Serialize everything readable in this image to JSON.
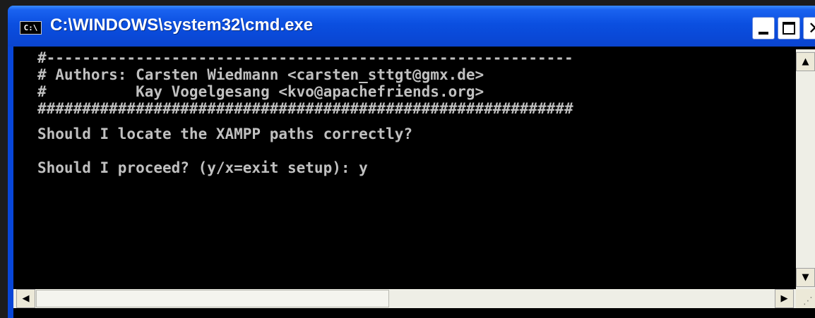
{
  "window": {
    "title": "C:\\WINDOWS\\system32\\cmd.exe",
    "icon_label": "C:\\"
  },
  "controls": {
    "minimize_icon": "minimize-icon",
    "maximize_icon": "maximize-icon",
    "close_glyph": "✕"
  },
  "console": {
    "lines": [
      "#-----------------------------------------------------------",
      "# Authors: Carsten Wiedmann <carsten_sttgt@gmx.de>",
      "#          Kay Vogelgesang <kvo@apachefriends.org>",
      "############################################################",
      "",
      "Should I locate the XAMPP paths correctly?",
      "Should I proceed? (y/x=exit setup): y"
    ]
  },
  "scrollbars": {
    "up_glyph": "▲",
    "down_glyph": "▼",
    "left_glyph": "◀",
    "right_glyph": "▶",
    "grip_glyph": "⋰"
  }
}
